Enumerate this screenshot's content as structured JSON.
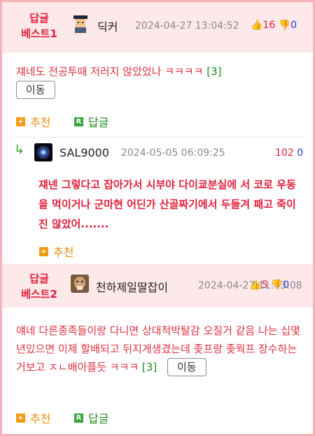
{
  "comments": [
    {
      "best_label_line1": "답글",
      "best_label_line2": "베스트1",
      "nickname": "딕커",
      "date": "2024-04-27 13:04:52",
      "upvotes": "16",
      "downvotes": "0",
      "content": "쟤네도 전공투때 저러지 않았었나 ㅋㅋㅋㅋ",
      "reply_count": "[3]",
      "move_label": "이동",
      "recommend_label": "추천",
      "reply_label": "답글"
    },
    {
      "best_label_line1": "답글",
      "best_label_line2": "베스트2",
      "nickname": "천하제일딸잡이",
      "date": "2024-04-27 11:43:08",
      "upvotes": "5",
      "downvotes": "0",
      "content": "얘네 다른종족들이랑 다니면 상대적박탈감 오질거 같음 나는 십몇년있으면 이제 할배되고 뒤지게생겼는데 좆프랑 좆웍프 장수하는거보고 ㅈㄴ배아플듯 ㅋㅋㅋ",
      "reply_count": "[3]",
      "move_label": "이동",
      "recommend_label": "추천",
      "reply_label": "답글"
    }
  ],
  "reply": {
    "arrow": "↳",
    "nickname": "SAL9000",
    "date": "2024-05-05 06:09:25",
    "upvotes": "102",
    "downvotes": "0",
    "content": "쟤넨 그렇다고 잡아가서 시부야 다이쿄분실에 서 코로 우동을 먹이거나 군마현 어딘가 산골짜기에서 두들겨 패고 죽이진 않았어.......",
    "recommend_label": "추천"
  },
  "icons": {
    "thumb_up": "thumb-up-icon",
    "thumb_down": "thumb-down-icon",
    "recommend": "plus-square-icon",
    "reply": "r-square-icon"
  },
  "colors": {
    "accent_red": "#e0203a",
    "vote_blue": "#1f3fd0",
    "header_bg": "#fde8ea",
    "frame": "#f3b3b8",
    "green": "#1c8c1c",
    "orange": "#f09010"
  }
}
